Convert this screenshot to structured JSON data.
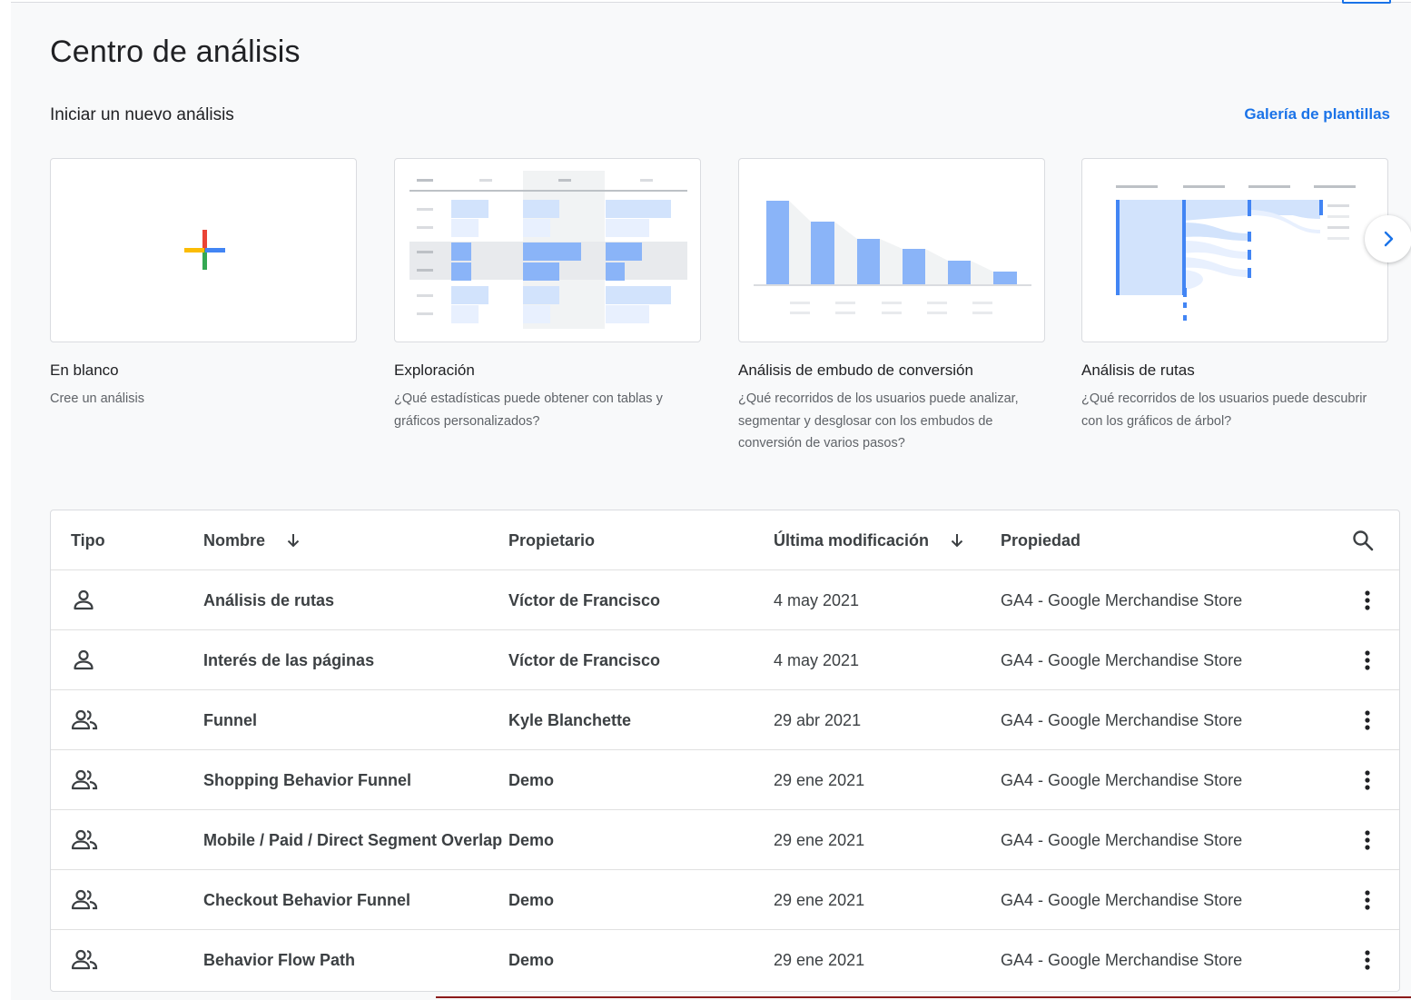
{
  "page": {
    "title": "Centro de análisis",
    "subtitle": "Iniciar un nuevo análisis",
    "gallery_link": "Galería de plantillas"
  },
  "cards": [
    {
      "title": "En blanco",
      "desc": "Cree un análisis",
      "icon": "plus-icon"
    },
    {
      "title": "Exploración",
      "desc": "¿Qué estadísticas puede obtener con tablas y gráficos personalizados?",
      "icon": "exploration-thumbnail"
    },
    {
      "title": "Análisis de embudo de conversión",
      "desc": "¿Qué recorridos de los usuarios puede analizar, segmentar y desglosar con los embudos de conversión de varios pasos?",
      "icon": "funnel-thumbnail"
    },
    {
      "title": "Análisis de rutas",
      "desc": "¿Qué recorridos de los usuarios puede descubrir con los gráficos de árbol?",
      "icon": "path-thumbnail"
    }
  ],
  "table": {
    "headers": {
      "type": "Tipo",
      "name": "Nombre",
      "owner": "Propietario",
      "modified": "Última modificación",
      "property": "Propiedad"
    },
    "rows": [
      {
        "type": "person-icon",
        "name": "Análisis de rutas",
        "owner": "Víctor de Francisco",
        "modified": "4 may 2021",
        "property": "GA4 - Google Merchandise Store"
      },
      {
        "type": "person-icon",
        "name": "Interés de las páginas",
        "owner": "Víctor de Francisco",
        "modified": "4 may 2021",
        "property": "GA4 - Google Merchandise Store"
      },
      {
        "type": "group-icon",
        "name": "Funnel",
        "owner": "Kyle Blanchette",
        "modified": "29 abr 2021",
        "property": "GA4 - Google Merchandise Store"
      },
      {
        "type": "group-icon",
        "name": "Shopping Behavior Funnel",
        "owner": "Demo",
        "modified": "29 ene 2021",
        "property": "GA4 - Google Merchandise Store"
      },
      {
        "type": "group-icon",
        "name": "Mobile / Paid / Direct Segment Overlap",
        "owner": "Demo",
        "modified": "29 ene 2021",
        "property": "GA4 - Google Merchandise Store"
      },
      {
        "type": "group-icon",
        "name": "Checkout Behavior Funnel",
        "owner": "Demo",
        "modified": "29 ene 2021",
        "property": "GA4 - Google Merchandise Store"
      },
      {
        "type": "group-icon",
        "name": "Behavior Flow Path",
        "owner": "Demo",
        "modified": "29 ene 2021",
        "property": "GA4 - Google Merchandise Store"
      }
    ]
  },
  "colors": {
    "accent": "#1a73e8",
    "chart_blue": "#8ab4f8",
    "chart_blue_light": "#d2e3fc"
  }
}
